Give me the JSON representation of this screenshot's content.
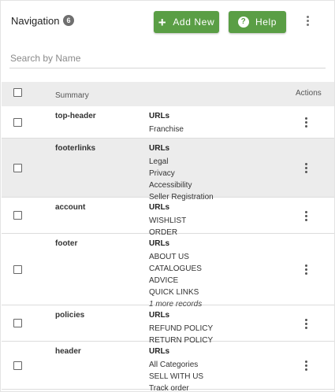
{
  "header": {
    "title": "Navigation",
    "count": "6",
    "add_label": "Add New",
    "help_label": "Help"
  },
  "search": {
    "placeholder": "Search by Name",
    "value": ""
  },
  "table": {
    "summary_header": "Summary",
    "actions_header": "Actions",
    "rows": [
      {
        "name": "top-header",
        "urls_title": "URLs",
        "links": [
          "Franchise"
        ],
        "more": ""
      },
      {
        "name": "footerlinks",
        "urls_title": "URLs",
        "links": [
          "Legal",
          "Privacy",
          "Accessibility",
          "Seller Registration"
        ],
        "more": ""
      },
      {
        "name": "account",
        "urls_title": "URLs",
        "links": [
          "WISHLIST",
          "ORDER"
        ],
        "more": ""
      },
      {
        "name": "footer",
        "urls_title": "URLs",
        "links": [
          "ABOUT US",
          "CATALOGUES",
          "ADVICE",
          "QUICK LINKS"
        ],
        "more": "1 more records"
      },
      {
        "name": "policies",
        "urls_title": "URLs",
        "links": [
          "REFUND POLICY",
          "RETURN POLICY"
        ],
        "more": ""
      },
      {
        "name": "header",
        "urls_title": "URLs",
        "links": [
          "All Categories",
          "SELL WITH US",
          "Track order"
        ],
        "more": ""
      }
    ]
  },
  "colors": {
    "accent": "#5a9e45",
    "row_highlight": "#ececec",
    "badge": "#6f6f6f"
  },
  "icons": {
    "add": "plus-icon",
    "help": "help-icon",
    "more": "kebab-menu-icon",
    "select": "checkbox-icon"
  }
}
